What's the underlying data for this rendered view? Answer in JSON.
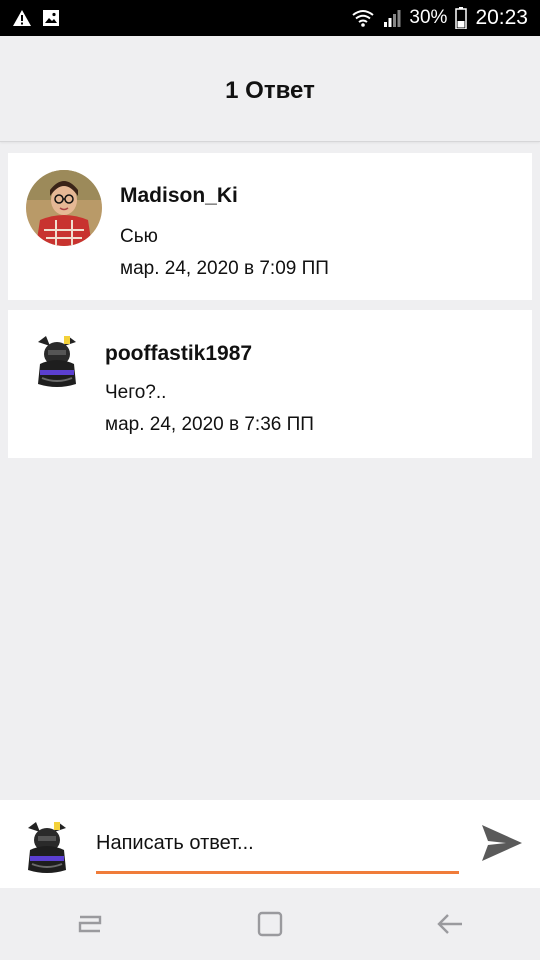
{
  "status_bar": {
    "left_icons": [
      "warning-icon",
      "image-icon"
    ],
    "battery_percent": "30%",
    "time": "20:23"
  },
  "header": {
    "title": "1 Ответ"
  },
  "comments": [
    {
      "username": "Madison_Ki",
      "message": "Сью",
      "timestamp": "мар. 24, 2020 в 7:09 ПП"
    },
    {
      "username": "pooffastik1987",
      "message": "Чего?..",
      "timestamp": "мар. 24, 2020 в 7:36 ПП"
    }
  ],
  "reply": {
    "placeholder": "Написать ответ...",
    "value": "",
    "send_icon": "send-icon"
  },
  "nav": {
    "items": [
      "recent-apps-icon",
      "home-icon",
      "back-icon"
    ]
  },
  "colors": {
    "accent": "#f07c3a",
    "background": "#efeff1",
    "card": "#ffffff",
    "status_bar": "#000000"
  }
}
